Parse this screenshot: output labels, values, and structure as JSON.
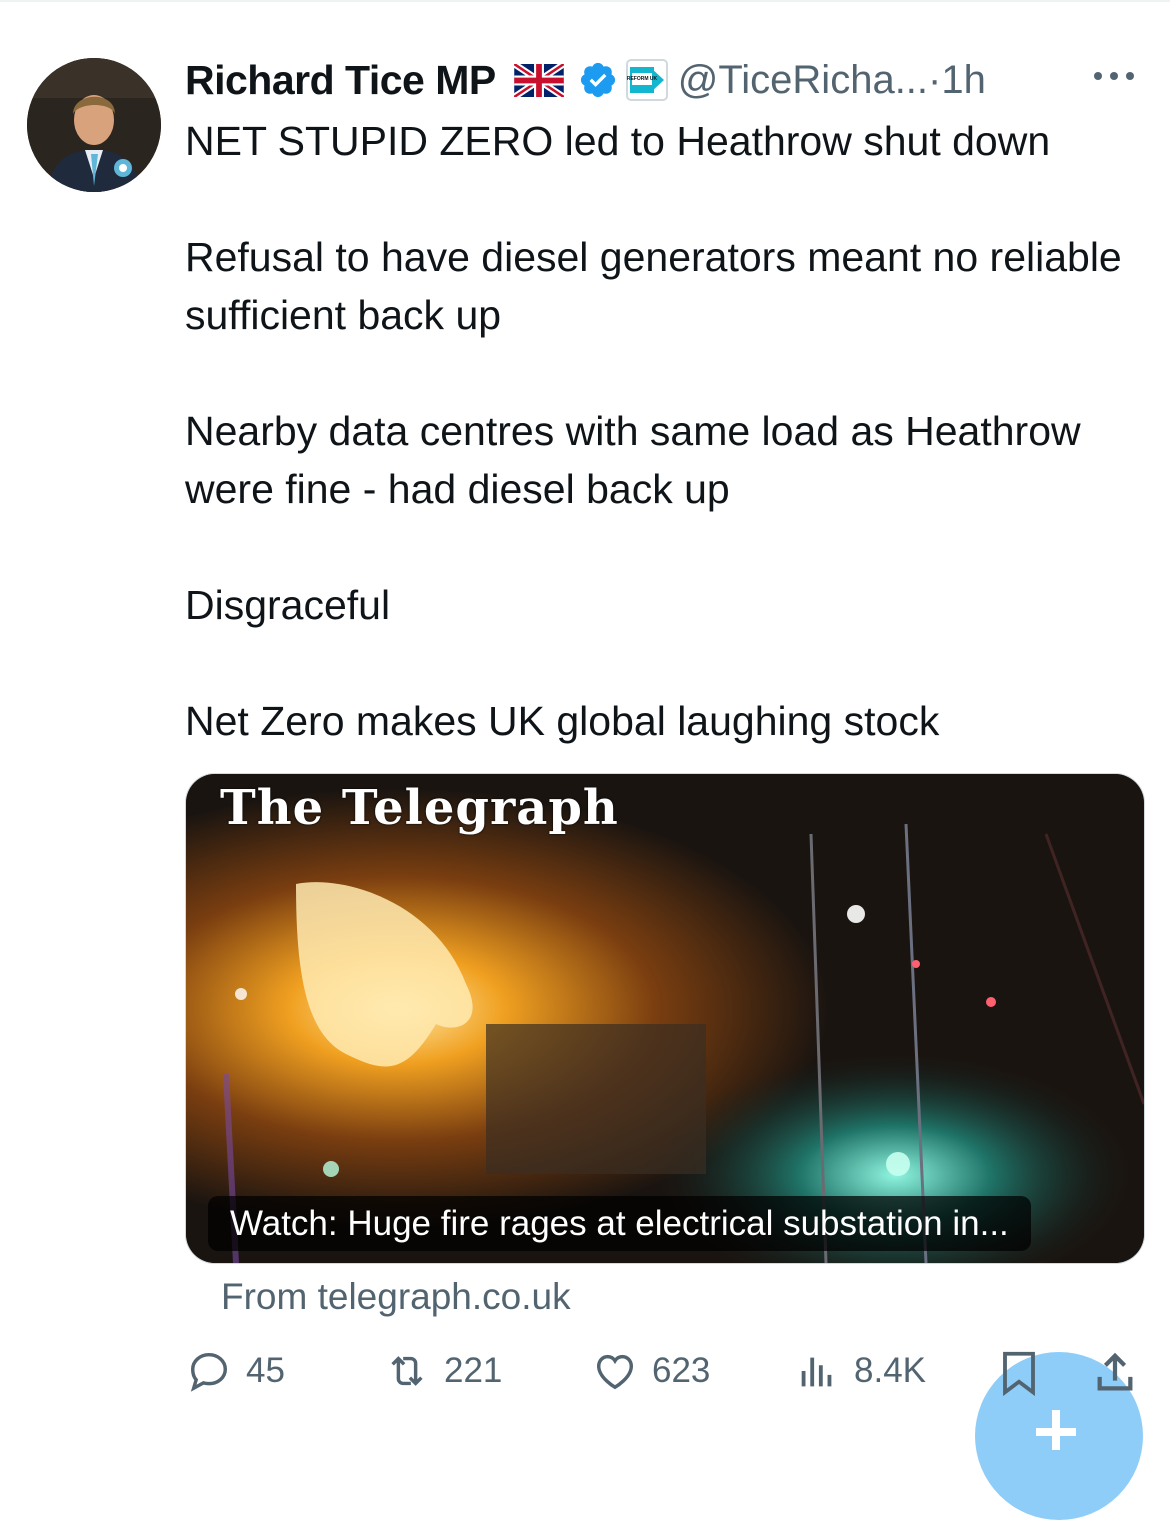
{
  "author": {
    "name": "Richard Tice MP",
    "handle": "@TiceRicha...",
    "time_sep": " · ",
    "time": "1h",
    "flag_icon": "uk-flag-icon",
    "verified_icon": "verified-badge-icon",
    "affiliate_icon": "reform-uk-affiliate-icon",
    "affiliate_label": "REFORM UK",
    "verified_color": "#1d9bf0"
  },
  "tweet": {
    "paragraphs": [
      "NET STUPID ZERO led to Heathrow shut down",
      "Refusal to have diesel generators meant no reliable sufficient back up",
      "Nearby data centres with same load as Heathrow were fine - had diesel back up",
      "Disgraceful",
      "Net Zero makes UK global laughing stock"
    ]
  },
  "card": {
    "brand": "The Telegraph",
    "caption": "Watch: Huge fire rages at electrical substation in...",
    "source": "From telegraph.co.uk"
  },
  "actions": {
    "replies": "45",
    "retweets": "221",
    "likes": "623",
    "views": "8.4K"
  },
  "colors": {
    "text": "#0f1419",
    "secondary": "#536471",
    "fab": "#8ecdf8"
  }
}
